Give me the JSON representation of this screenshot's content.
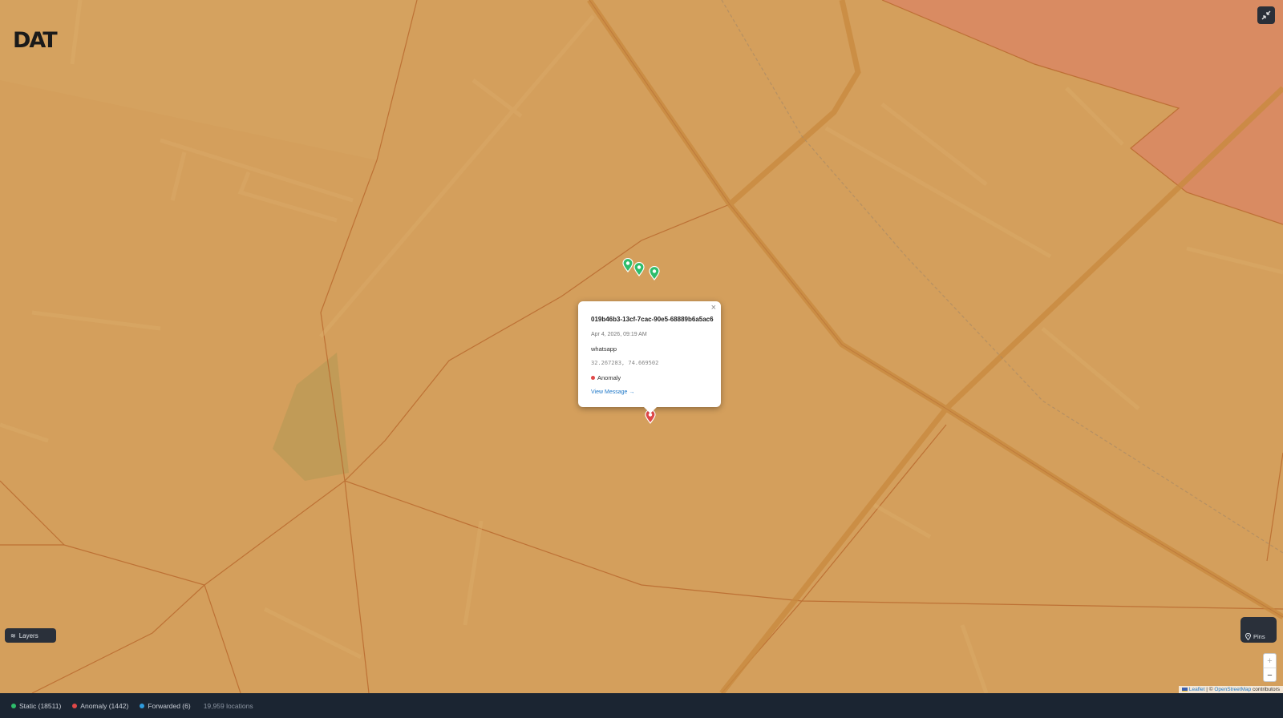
{
  "map": {
    "logo_text": "DAT",
    "fullscreen_icon": "collapse-icon",
    "pins": [
      {
        "status": "static",
        "color": "#2ebd6b"
      },
      {
        "status": "static",
        "color": "#2ebd6b"
      },
      {
        "status": "static",
        "color": "#2ebd6b"
      },
      {
        "status": "anomaly",
        "color": "#e04848"
      }
    ]
  },
  "popup": {
    "id": "019b46b3-13cf-7cac-90e5-68889b6a5ac6",
    "date": "Apr 4, 2026, 09:19 AM",
    "app": "whatsapp",
    "coords": "32.267283, 74.669502",
    "status": "Anomaly",
    "status_color": "#e04848",
    "link": "View Message →",
    "close": "×"
  },
  "controls": {
    "layers_label": "Layers",
    "layers_icon": "layers-icon",
    "pins_label": "Pins",
    "pins_icon": "map-pin-icon",
    "zoom_in": "+",
    "zoom_out": "−"
  },
  "attribution": {
    "leaflet": "Leaflet",
    "separator": "|",
    "osm_prefix": "©",
    "osm": "OpenStreetMap",
    "suffix": "contributors"
  },
  "footer": {
    "legend": [
      {
        "label": "Static (18511)",
        "color": "#2ebd6b"
      },
      {
        "label": "Anomaly (1442)",
        "color": "#e04848"
      },
      {
        "label": "Forwarded (6)",
        "color": "#2f9bdc"
      }
    ],
    "count": "19,959 locations"
  }
}
